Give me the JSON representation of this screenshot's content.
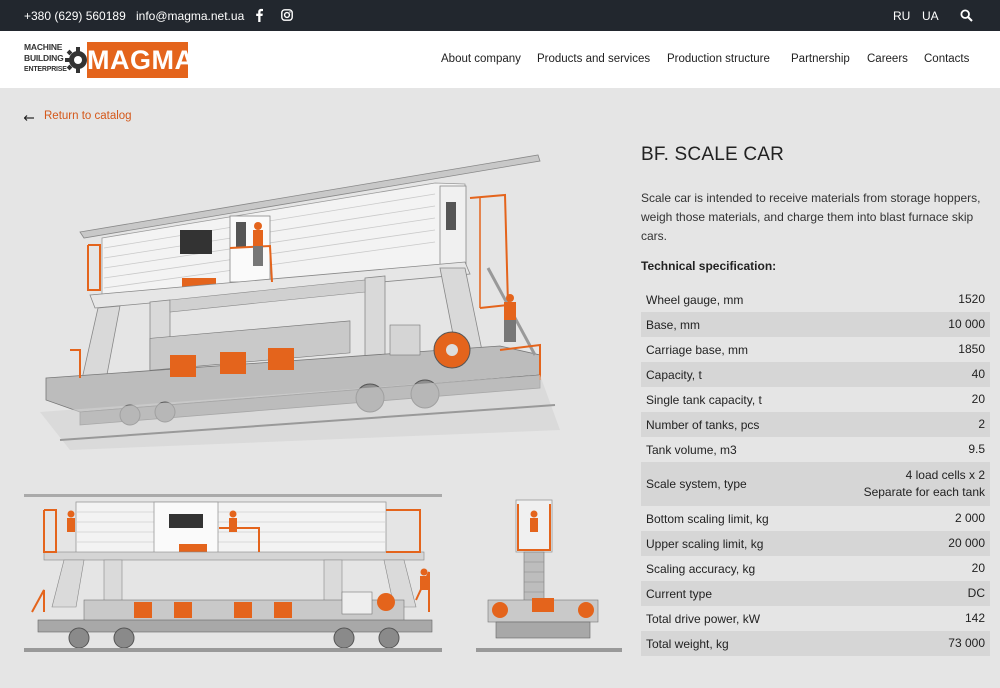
{
  "topbar": {
    "phone": "+380 (629) 560189",
    "email": "info@magma.net.ua",
    "languages": [
      "RU",
      "UA"
    ],
    "icons": [
      "facebook-icon",
      "instagram-icon",
      "search-icon"
    ]
  },
  "logo": {
    "line1": "MACHINE",
    "line2": "BUILDING",
    "line3": "ENTERPRISE",
    "brand": "MAGMA"
  },
  "nav": [
    "About company",
    "Products and services",
    "Production structure",
    "Partnership",
    "Careers",
    "Contacts"
  ],
  "back_link": "Return to catalog",
  "product": {
    "title": "BF. SCALE CAR",
    "description": "Scale car is intended to receive materials from storage hoppers, weigh those materials, and charge them into blast furnace skip cars.",
    "spec_heading": "Technical specification:",
    "specs": [
      {
        "label": "Wheel gauge, mm",
        "value": "1520"
      },
      {
        "label": "Base, mm",
        "value": "10 000"
      },
      {
        "label": "Carriage base, mm",
        "value": "1850"
      },
      {
        "label": "Capacity, t",
        "value": "40"
      },
      {
        "label": "Single tank capacity, t",
        "value": "20"
      },
      {
        "label": "Number of tanks, pcs",
        "value": "2"
      },
      {
        "label": "Tank volume, m3",
        "value": "9.5"
      },
      {
        "label": "Scale system, type",
        "value": "4 load cells x 2\nSeparate for each tank"
      },
      {
        "label": "Bottom scaling limit, kg",
        "value": "2 000"
      },
      {
        "label": "Upper scaling limit, kg",
        "value": "20 000"
      },
      {
        "label": "Scaling accuracy, kg",
        "value": "20"
      },
      {
        "label": "Current type",
        "value": "DC"
      },
      {
        "label": "Total drive power, kW",
        "value": "142"
      },
      {
        "label": "Total weight, kg",
        "value": "73 000"
      }
    ]
  },
  "colors": {
    "accent": "#e4641c",
    "topbar": "#22272e",
    "background": "#e5e5e5"
  }
}
